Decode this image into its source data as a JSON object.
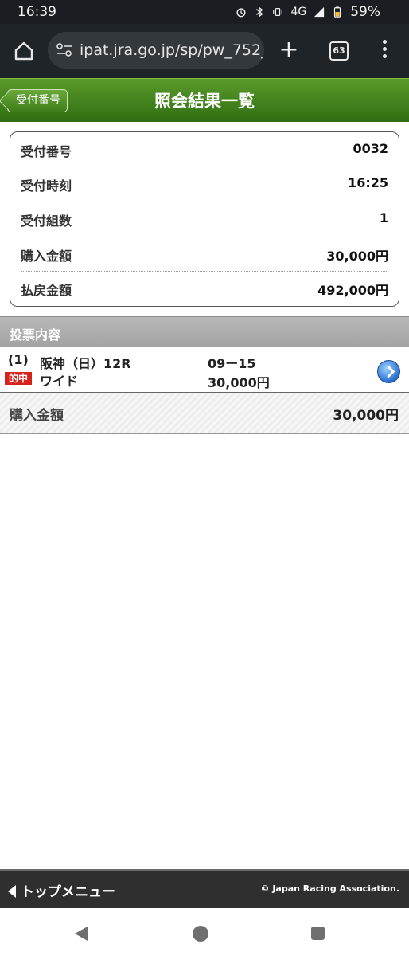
{
  "status_bar": {
    "time": "16:39",
    "network": "4G",
    "battery": "59%"
  },
  "browser": {
    "url": "ipat.jra.go.jp/sp/pw_752_i",
    "tab_count": "63",
    "new_tab_symbol": "+"
  },
  "header": {
    "back_label": "受付番号",
    "title": "照会結果一覧"
  },
  "summary": [
    {
      "label": "受付番号",
      "value": "0032"
    },
    {
      "label": "受付時刻",
      "value": "16:25"
    },
    {
      "label": "受付組数",
      "value": "1"
    },
    {
      "label": "購入金額",
      "value": "30,000円"
    },
    {
      "label": "払戻金額",
      "value": "492,000円"
    }
  ],
  "section": {
    "title": "投票内容"
  },
  "vote": {
    "number": "(1)",
    "venue_race": "阪神（日）12R",
    "combination": "09ー15",
    "hit_badge": "的中",
    "bet_type": "ワイド",
    "amount": "30,000円"
  },
  "total": {
    "label": "購入金額",
    "value": "30,000円"
  },
  "footer": {
    "top_menu": "トップメニュー",
    "copyright": "© Japan Racing Association."
  },
  "colors": {
    "header_green": "#3f7f1c",
    "hit_red": "#d8221c",
    "section_gray": "#aaaaaa",
    "footer_dark": "#2f2f2f"
  }
}
